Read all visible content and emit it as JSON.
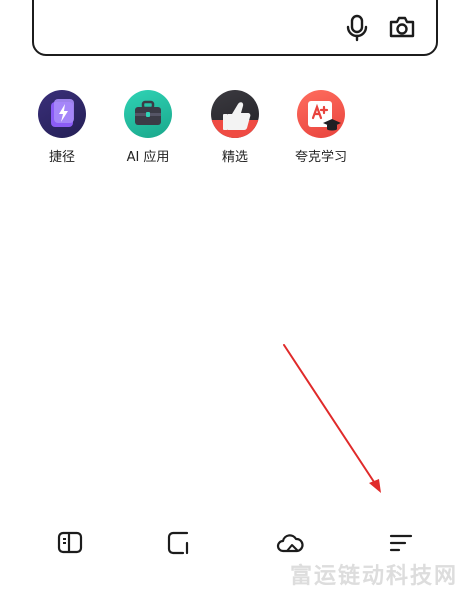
{
  "search": {
    "mic_icon": "microphone-icon",
    "camera_icon": "camera-icon"
  },
  "shortcuts": [
    {
      "label": "捷径",
      "icon": "lightning-card-icon",
      "color": "#2f2866"
    },
    {
      "label": "AI 应用",
      "icon": "briefcase-icon",
      "color": "#22bc9f"
    },
    {
      "label": "精选",
      "icon": "thumbs-up-icon",
      "color": "#2d2c31"
    },
    {
      "label": "夸克学习",
      "icon": "graduation-cap-icon",
      "color": "#f0544a"
    }
  ],
  "bottom_nav": [
    {
      "icon": "book-icon"
    },
    {
      "icon": "tabs-window-icon"
    },
    {
      "icon": "cloud-icon"
    },
    {
      "icon": "menu-lines-icon"
    }
  ],
  "annotation": {
    "arrow_color": "#e02a2a"
  },
  "watermark": "富运链动科技网"
}
